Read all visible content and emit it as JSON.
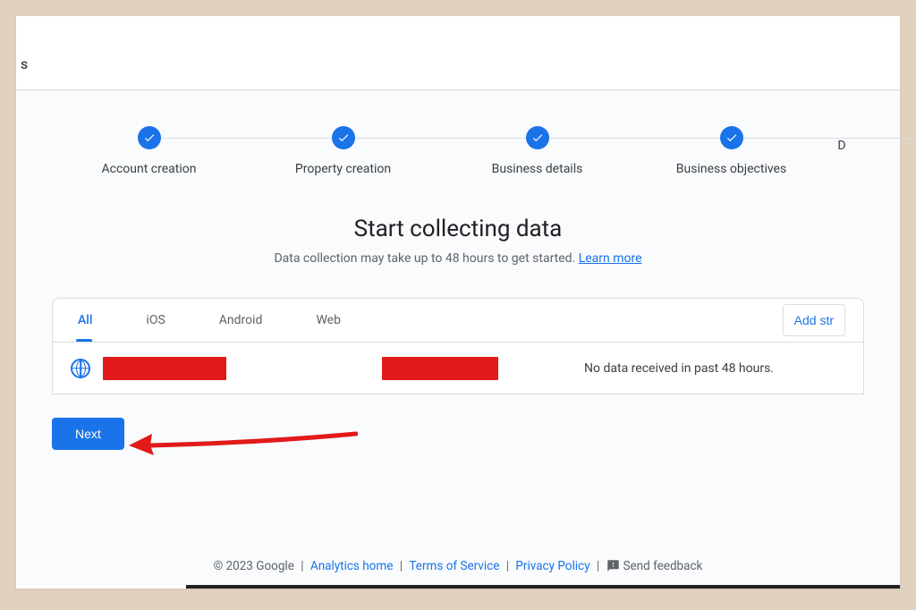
{
  "topbar": {
    "corner": "s"
  },
  "stepper": {
    "steps": [
      {
        "label": "Account creation"
      },
      {
        "label": "Property creation"
      },
      {
        "label": "Business details"
      },
      {
        "label": "Business objectives"
      }
    ],
    "partial_label": "D"
  },
  "headline": "Start collecting data",
  "subhead": {
    "text": "Data collection may take up to 48 hours to get started. ",
    "link": "Learn more"
  },
  "stream_tabs": {
    "all": "All",
    "ios": "iOS",
    "android": "Android",
    "web": "Web",
    "add_button": "Add str"
  },
  "stream_row": {
    "status": "No data received in past 48 hours."
  },
  "next_button": "Next",
  "footer": {
    "copyright": "© 2023 Google",
    "analytics_home": "Analytics home",
    "terms": "Terms of Service",
    "privacy": "Privacy Policy",
    "feedback": "Send feedback"
  }
}
